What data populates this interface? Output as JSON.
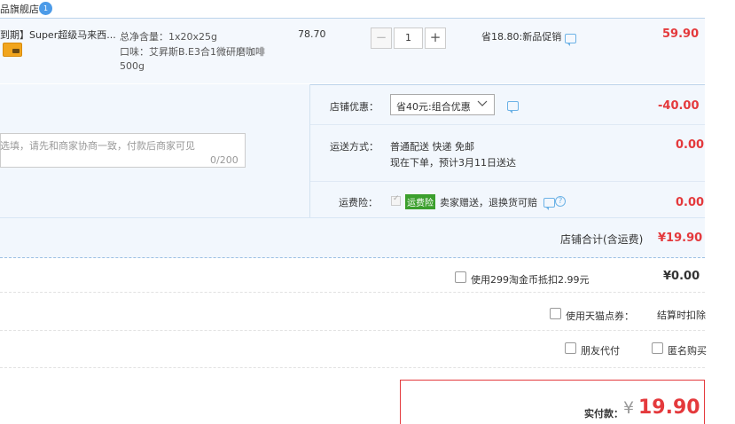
{
  "shop": {
    "name": "品旗舰店",
    "badge": "1"
  },
  "item": {
    "title": "到期】Super超级马来西...",
    "card_icon": "card-icon",
    "spec_net": "总净含量：1x20x25g",
    "spec_flavor": "口味：艾昇斯B.E3合1微研磨咖啡",
    "spec_weight": "500g",
    "unit_price": "78.70",
    "quantity": "1",
    "minus_label": "−",
    "plus_label": "+",
    "promo": "省18.80:新品促销",
    "subtotal": "59.90"
  },
  "memo": {
    "placeholder": "选填，请先和商家协商一致，付款后商家可见",
    "count": "0/200"
  },
  "discount": {
    "label": "店铺优惠：",
    "selected": "省40元:组合优惠",
    "amount": "-40.00"
  },
  "delivery": {
    "label": "运送方式：",
    "method": "普通配送 快递 免邮",
    "eta": "现在下单，预计3月11日送达",
    "amount": "0.00"
  },
  "insurance": {
    "label": "运费险：",
    "tag": "运费险",
    "desc": "卖家赠送，退换货可赔",
    "help": "?",
    "amount": "0.00"
  },
  "shop_total": {
    "label": "店铺合计(含运费)",
    "amount": "¥19.90"
  },
  "coins": {
    "label": "使用299淘金币抵扣2.99元",
    "amount": "¥0.00"
  },
  "points": {
    "label": "使用天猫点券：",
    "note": "结算时扣除"
  },
  "options": {
    "friend_pay": "朋友代付",
    "anonymous": "匿名购买"
  },
  "payment": {
    "label": "实付款：",
    "currency": "¥",
    "amount": "19.90"
  },
  "colors": {
    "price_red": "#e4393c",
    "row_bg": "#f2f7fd",
    "tag_green": "#3b9f2d"
  }
}
